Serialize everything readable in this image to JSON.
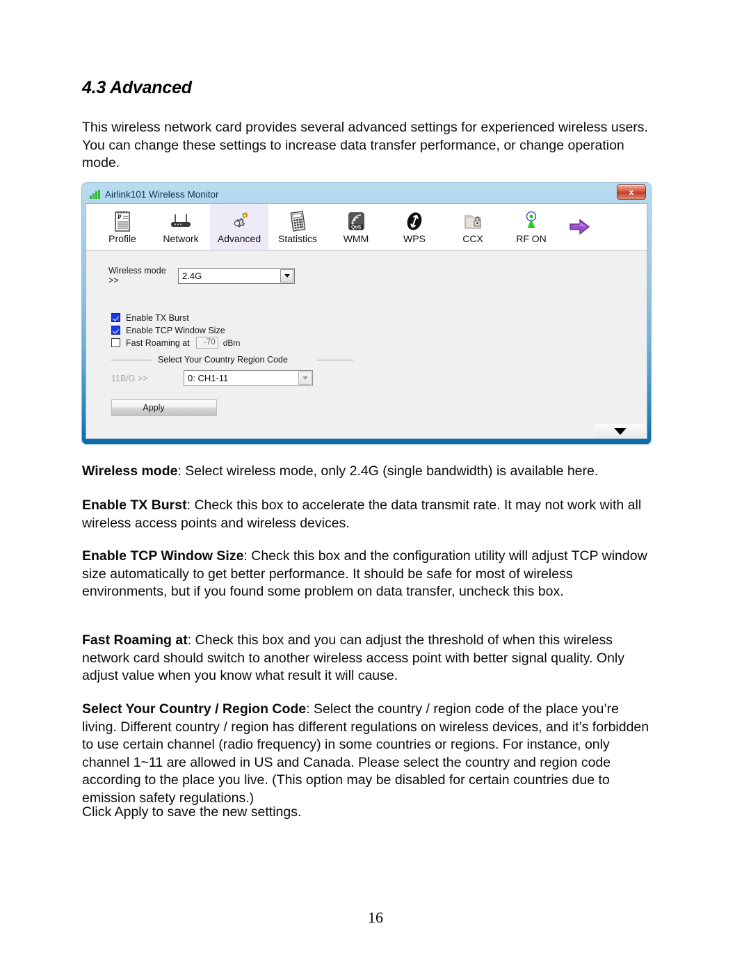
{
  "document": {
    "heading": "4.3 Advanced",
    "intro": "This wireless network card provides several advanced settings for experienced wireless users. You can change these settings to increase data transfer performance, or change operation mode.",
    "page_number": "16",
    "paragraphs": {
      "wireless_mode_term": "Wireless mode",
      "wireless_mode_body": ": Select wireless mode, only 2.4G (single bandwidth) is available here.",
      "tx_burst_term": "Enable TX Burst",
      "tx_burst_body": ": Check this box to accelerate the data transmit rate. It may not work with all wireless access points and wireless devices.",
      "tcp_window_term": "Enable TCP Window Size",
      "tcp_window_body": ": Check this box and the configuration utility will adjust TCP window size automatically to get better performance. It should be safe for most of wireless environments, but if you found some problem on data transfer, uncheck this box.",
      "fast_roaming_term": "Fast Roaming at",
      "fast_roaming_body": ": Check this box and you can adjust the threshold of when this wireless network card should switch to another wireless access point with better signal quality. Only adjust value when you know what result it will cause.",
      "region_term": "Select Your Country / Region Code",
      "region_body": ": Select the country / region code of the place you’re living. Different country / region has different regulations on wireless devices, and it’s forbidden to use certain channel (radio frequency) in some countries or regions. For instance, only channel 1~11 are allowed in US and Canada. Please select the country and region code according to the place you live. (This option may be disabled for certain countries due to emission safety regulations.)",
      "apply_note": "Click Apply to save the new settings."
    }
  },
  "app": {
    "title": "Airlink101 Wireless Monitor",
    "close_label": "x",
    "toolbar": [
      {
        "label": "Profile",
        "icon": "profile-notepad-icon",
        "active": false
      },
      {
        "label": "Network",
        "icon": "router-icon",
        "active": false
      },
      {
        "label": "Advanced",
        "icon": "gears-icon",
        "active": true
      },
      {
        "label": "Statistics",
        "icon": "calculator-icon",
        "active": false
      },
      {
        "label": "WMM",
        "icon": "qos-badge-icon",
        "active": false
      },
      {
        "label": "WPS",
        "icon": "wps-arrows-icon",
        "active": false
      },
      {
        "label": "CCX",
        "icon": "folder-lock-icon",
        "active": false
      },
      {
        "label": "RF ON",
        "icon": "antenna-icon",
        "active": false
      }
    ],
    "exit_icon": "purple-right-arrow-icon",
    "form": {
      "wireless_mode_label": "Wireless mode >>",
      "wireless_mode_value": "2.4G",
      "checkboxes": [
        {
          "label": "Enable TX Burst",
          "checked": true
        },
        {
          "label": "Enable TCP Window Size",
          "checked": true
        },
        {
          "label": "Fast Roaming at",
          "checked": false
        }
      ],
      "fast_roaming_value": "-70",
      "fast_roaming_unit": "dBm",
      "group_title": "Select Your Country Region Code",
      "region_label": "11B/G >>",
      "region_value": "0: CH1-11",
      "apply_label": "Apply"
    },
    "colors": {
      "title_bar": "#8ec0de",
      "accent_blue": "#1f7cb8",
      "checkbox_blue": "#1a39e8",
      "active_tab": "#efeaf7",
      "close_red": "#c0412c",
      "logo_green": "#2db82d"
    }
  }
}
